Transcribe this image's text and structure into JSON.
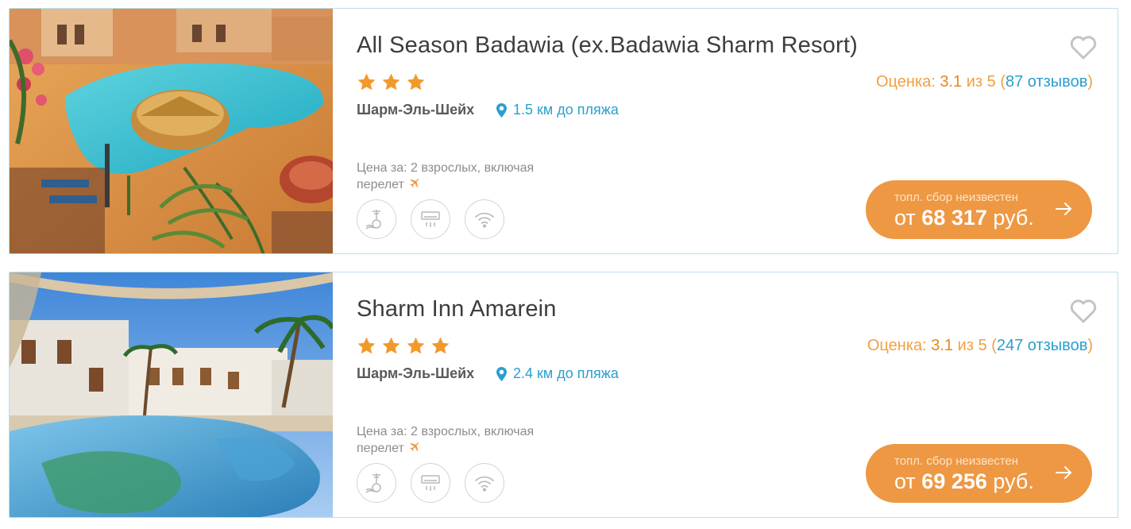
{
  "hotels": [
    {
      "name": "All Season Badawia (ex.Badawia Sharm Resort)",
      "stars": 3,
      "city": "Шарм-Эль-Шейх",
      "beach": "1.5 км до пляжа",
      "rating_prefix": "Оценка: ",
      "rating_score": "3.1",
      "rating_mid": " из 5 (",
      "reviews": "87 отзывов",
      "rating_suffix": ")",
      "price_note_line1": "Цена за: 2 взрослых, включая",
      "price_note_line2": "перелет",
      "fee_note": "топл. сбор неизвестен",
      "price_prefix": "от ",
      "price_value": "68 317",
      "price_currency": " руб.",
      "amenities": [
        "beach-icon",
        "air-conditioner-icon",
        "wifi-icon"
      ]
    },
    {
      "name": "Sharm Inn Amarein",
      "stars": 4,
      "city": "Шарм-Эль-Шейх",
      "beach": "2.4 км до пляжа",
      "rating_prefix": "Оценка: ",
      "rating_score": "3.1",
      "rating_mid": " из 5 (",
      "reviews": "247 отзывов",
      "rating_suffix": ")",
      "price_note_line1": "Цена за: 2 взрослых, включая",
      "price_note_line2": "перелет",
      "fee_note": "топл. сбор неизвестен",
      "price_prefix": "от ",
      "price_value": "69 256",
      "price_currency": " руб.",
      "amenities": [
        "beach-icon",
        "air-conditioner-icon",
        "wifi-icon"
      ]
    }
  ],
  "colors": {
    "accent_orange": "#ee9843",
    "star": "#f19a2c",
    "link_blue": "#2a9fd0",
    "card_border": "#bcdfea"
  }
}
